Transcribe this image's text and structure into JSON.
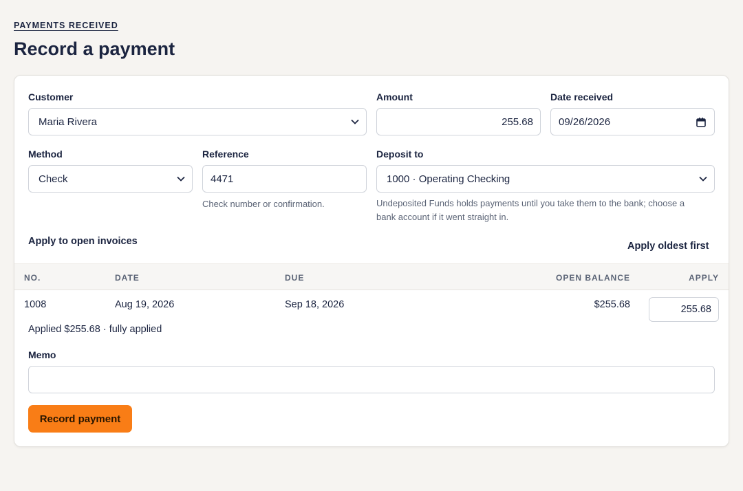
{
  "breadcrumb": "PAYMENTS RECEIVED",
  "title": "Record a payment",
  "form": {
    "customer": {
      "label": "Customer",
      "value": "Maria Rivera"
    },
    "amount": {
      "label": "Amount",
      "value": "255.68"
    },
    "date_received": {
      "label": "Date received",
      "value": "09/26/2026"
    },
    "method": {
      "label": "Method",
      "value": "Check"
    },
    "reference": {
      "label": "Reference",
      "value": "4471",
      "hint": "Check number or confirmation."
    },
    "deposit_to": {
      "label": "Deposit to",
      "value": "1000 · Operating Checking",
      "hint_line1": "Undeposited Funds holds payments until you take them to the bank; choose a",
      "hint_line2": "bank account if it went straight in."
    }
  },
  "invoices": {
    "section_label": "Apply to open invoices",
    "apply_oldest_label": "Apply oldest first",
    "columns": [
      "NO.",
      "DATE",
      "DUE",
      "OPEN BALANCE",
      "APPLY"
    ],
    "rows": [
      {
        "no": "1008",
        "date": "Aug 19, 2026",
        "due": "Sep 18, 2026",
        "open_balance": "$255.68",
        "apply": "255.68"
      }
    ],
    "summary": "Applied $255.68 · fully applied"
  },
  "memo": {
    "label": "Memo",
    "value": ""
  },
  "submit_label": "Record payment",
  "colors": {
    "accent": "#f97d16",
    "text": "#1b2440",
    "background": "#f6f4f1"
  },
  "icons": {
    "select": "chevron-down-icon",
    "date": "calendar-icon"
  }
}
